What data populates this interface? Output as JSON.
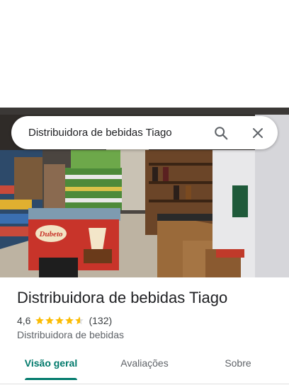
{
  "search": {
    "query": "Distribuidora de bebidas Tiago",
    "search_icon": "search-icon",
    "close_icon": "close-icon"
  },
  "place": {
    "name": "Distribuidora de bebidas Tiago",
    "rating": "4,6",
    "rating_value": 4.6,
    "rating_max": 5,
    "reviews_count": "(132)",
    "category": "Distribuidora de bebidas"
  },
  "photo": {
    "freezer_brand": "Dubeto"
  },
  "tabs": [
    {
      "label": "Visão geral",
      "active": true
    },
    {
      "label": "Avaliações",
      "active": false
    },
    {
      "label": "Sobre",
      "active": false
    }
  ],
  "colors": {
    "accent": "#00796b",
    "star": "#fbbc04",
    "star_empty": "#dadce0"
  }
}
